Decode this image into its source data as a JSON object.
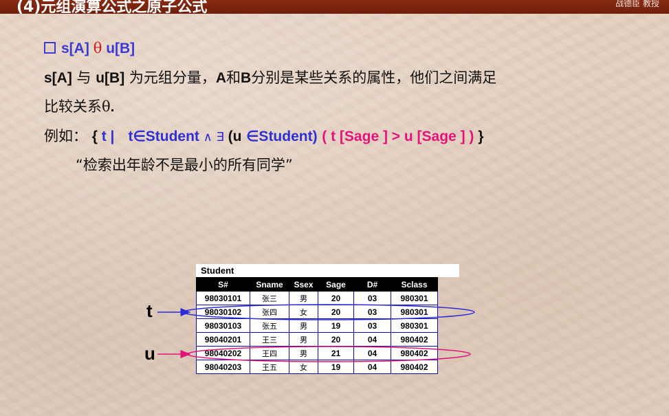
{
  "header": {
    "title": "(4)元组演算公式之原子公式",
    "author": "战德臣 教授"
  },
  "bullet": {
    "prefix": "s[A]",
    "op": "θ",
    "suffix": "u[B]"
  },
  "desc": {
    "a1": "s[A]",
    "t1": " 与 ",
    "a2": "u[B]",
    "t2": " 为元组分量，",
    "a3": "A",
    "t3": "和",
    "a4": "B",
    "t4": "分别是某些关系的属性，他们之间满足",
    "line2_text": "比较关系",
    "line2_theta": "θ",
    "line2_dot": "."
  },
  "example": {
    "label": "例如：",
    "open": "{",
    "t_bar": " t |",
    "t_in": "t∈Student",
    "and_exists": " ∧ ∃ ",
    "paren_u": "(u",
    "u_in": "∈Student)",
    "cond": "( t [Sage ] > u [Sage ] )",
    "close": " }",
    "explain": "“检索出年龄不是最小的所有同学”"
  },
  "relation": {
    "name": "Student",
    "columns": [
      "S#",
      "Sname",
      "Ssex",
      "Sage",
      "D#",
      "Sclass"
    ],
    "rows": [
      [
        "98030101",
        "张三",
        "男",
        "20",
        "03",
        "980301"
      ],
      [
        "98030102",
        "张四",
        "女",
        "20",
        "03",
        "980301"
      ],
      [
        "98030103",
        "张五",
        "男",
        "19",
        "03",
        "980301"
      ],
      [
        "98040201",
        "王三",
        "男",
        "20",
        "04",
        "980402"
      ],
      [
        "98040202",
        "王四",
        "男",
        "21",
        "04",
        "980402"
      ],
      [
        "98040203",
        "王五",
        "女",
        "19",
        "04",
        "980402"
      ]
    ]
  },
  "markers": {
    "t": "t",
    "u": "u",
    "t_highlight_color": "#2b2bd8",
    "u_highlight_color": "#e0147a"
  },
  "colors": {
    "header_bg": "#7a2410",
    "accent_blue": "#2f2fd2",
    "accent_pink": "#e3137a",
    "theta_red": "#d01a1a"
  }
}
